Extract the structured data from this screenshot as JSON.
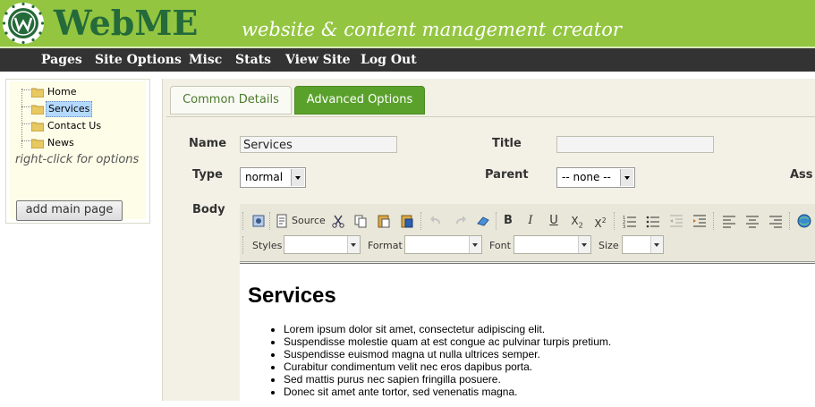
{
  "header": {
    "logo_text": "WebME",
    "tagline": "website & content management creator",
    "colors": {
      "header_bg": "#93c541",
      "logo_text": "#246a3a",
      "nav_bg": "#333333"
    }
  },
  "nav": {
    "items": [
      {
        "label": "Pages"
      },
      {
        "label": "Site Options"
      },
      {
        "label": "Misc"
      },
      {
        "label": "Stats"
      },
      {
        "label": "View Site"
      },
      {
        "label": "Log Out"
      }
    ]
  },
  "tree": {
    "items": [
      {
        "label": "Home",
        "selected": false
      },
      {
        "label": "Services",
        "selected": true
      },
      {
        "label": "Contact Us",
        "selected": false
      },
      {
        "label": "News",
        "selected": false
      }
    ],
    "hint": "right-click for options",
    "add_button": "add main page"
  },
  "tabs": {
    "common": "Common Details",
    "advanced": "Advanced Options"
  },
  "form": {
    "name_label": "Name",
    "name_value": "Services",
    "title_label": "Title",
    "title_value": "",
    "type_label": "Type",
    "type_value": "normal",
    "parent_label": "Parent",
    "parent_value": "-- none --",
    "ass_label": "Ass",
    "body_label": "Body"
  },
  "editor": {
    "toolbar": {
      "source_label": "Source",
      "styles_label": "Styles",
      "format_label": "Format",
      "font_label": "Font",
      "size_label": "Size"
    },
    "content": {
      "heading": "Services",
      "list": [
        "Lorem ipsum dolor sit amet, consectetur adipiscing elit.",
        "Suspendisse molestie quam at est congue ac pulvinar turpis pretium.",
        "Suspendisse euismod magna ut nulla ultrices semper.",
        "Curabitur condimentum velit nec eros dapibus porta.",
        "Sed mattis purus nec sapien fringilla posuere.",
        "Donec sit amet ante tortor, sed venenatis magna."
      ]
    }
  }
}
